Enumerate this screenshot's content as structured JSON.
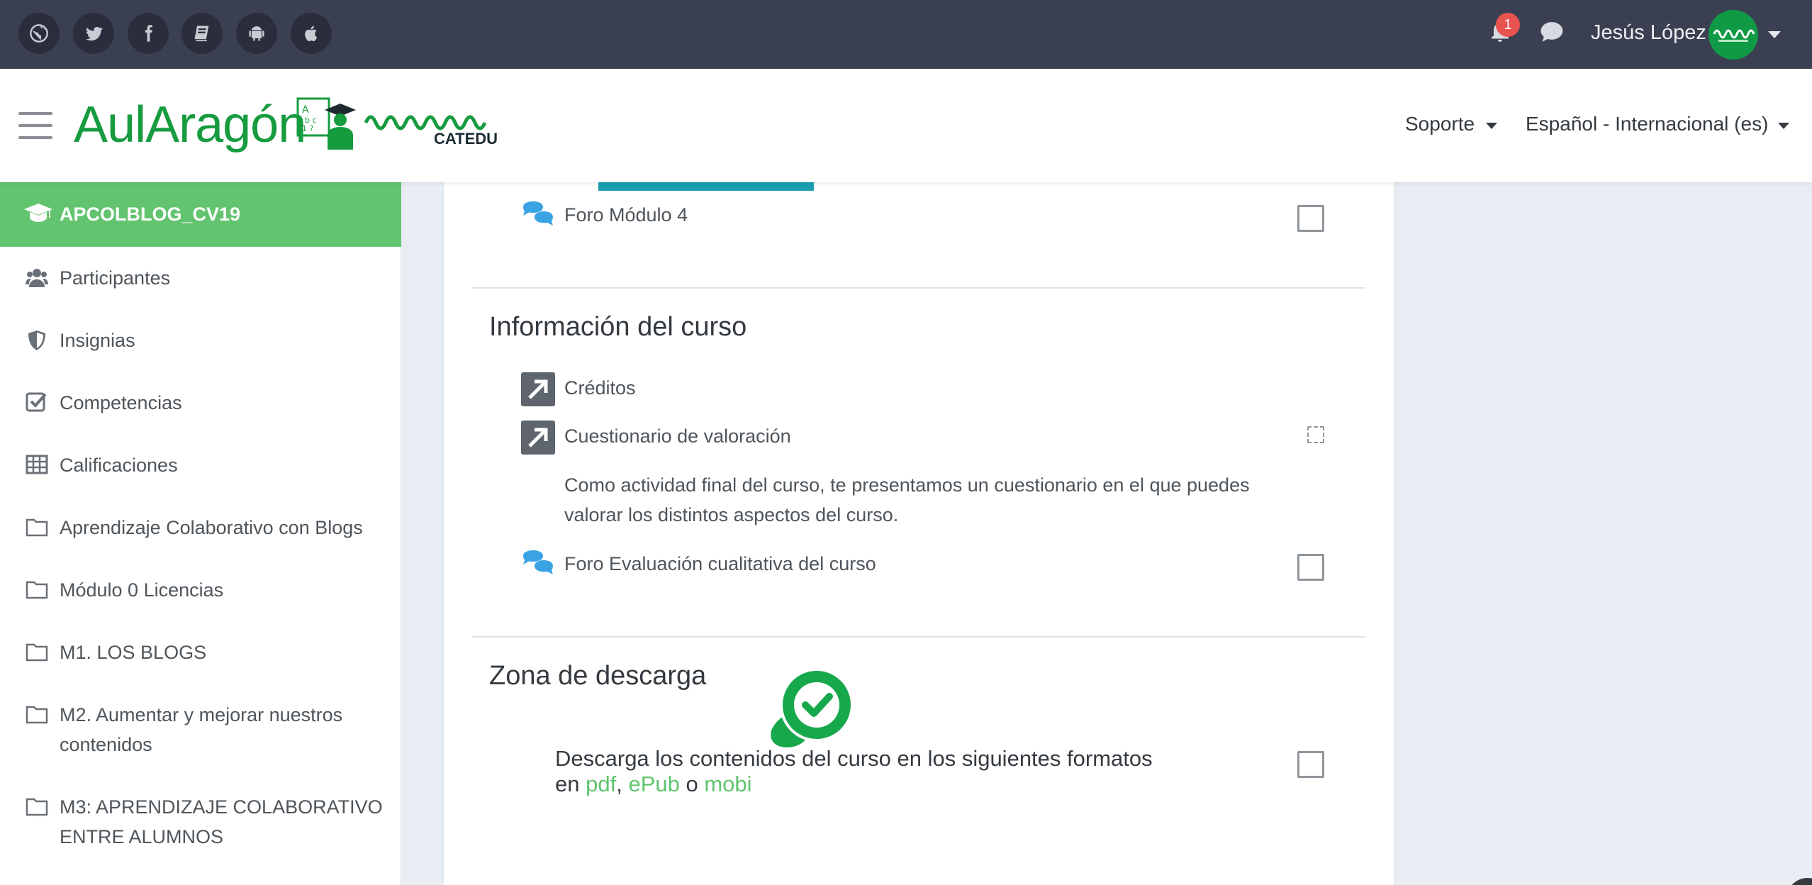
{
  "topbar": {
    "social_icons": [
      "globe-icon",
      "twitter-icon",
      "facebook-icon",
      "book-icon",
      "android-icon",
      "apple-icon"
    ],
    "notification_count": "1",
    "user_name": "Jesús López"
  },
  "header": {
    "logo_text": "AulAragón",
    "catedu_text": "CATEDU",
    "support_label": "Soporte",
    "language_label": "Español - Internacional (es)"
  },
  "sidebar": {
    "course": "APCOLBLOG_CV19",
    "items": [
      {
        "label": "Participantes",
        "icon": "users-icon"
      },
      {
        "label": "Insignias",
        "icon": "shield-icon"
      },
      {
        "label": "Competencias",
        "icon": "checkbox-icon"
      },
      {
        "label": "Calificaciones",
        "icon": "table-icon"
      },
      {
        "label": "Aprendizaje Colaborativo con Blogs",
        "icon": "folder-icon"
      },
      {
        "label": "Módulo 0 Licencias",
        "icon": "folder-icon"
      },
      {
        "label": "M1. LOS BLOGS",
        "icon": "folder-icon"
      },
      {
        "label": "M2. Aumentar y mejorar nuestros contenidos",
        "icon": "folder-icon"
      },
      {
        "label": "M3: APRENDIZAJE COLABORATIVO ENTRE ALUMNOS",
        "icon": "folder-icon"
      }
    ]
  },
  "content": {
    "forum_module4": "Foro Módulo 4",
    "section_info_title": "Información del curso",
    "creditos": "Créditos",
    "cuestionario": "Cuestionario de valoración",
    "cuestionario_desc": "Como actividad final del curso, te presentamos un cuestionario en el que puedes valorar los distintos aspectos del curso.",
    "forum_eval": "Foro Evaluación cualitativa del curso",
    "section_download_title": "Zona de descarga",
    "download_text": "Descarga los contenidos del curso en los siguientes formatos",
    "download_en": "en",
    "link_pdf": "pdf",
    "link_epub": "ePub",
    "download_o": "o",
    "link_mobi": "mobi"
  },
  "colors": {
    "topbar": "#3a3f51",
    "brand_green": "#169b3f",
    "active_sidebar": "#62c46f",
    "link_green": "#5fc46c",
    "forum_blue": "#3aa3e3",
    "url_icon_bg": "#5f656d"
  }
}
